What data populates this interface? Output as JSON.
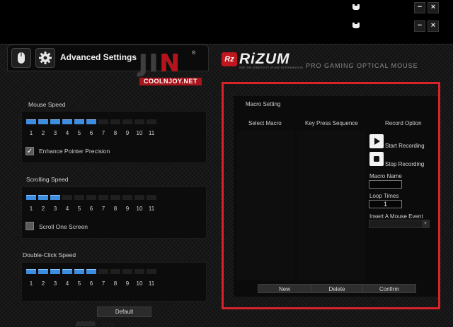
{
  "window": {
    "controls_top": {
      "minimize": "−",
      "close": "×"
    },
    "controls_second": {
      "minimize": "−",
      "close": "×"
    },
    "icons": [
      "mouse-small-icon",
      "mouse-small-icon"
    ]
  },
  "header": {
    "title": "Advanced Settings",
    "mouse_icon": "mouse-icon",
    "gear_icon": "gear-icon"
  },
  "watermark": {
    "logo_text_j": "JI",
    "logo_text_n": "N",
    "registered": "®",
    "site": "COOLNJOY.NET"
  },
  "brand": {
    "badge": "Rz",
    "name": "RiZUM",
    "tagline": "RISE THE SENSITIVITY UP AND DETERMINATION",
    "subtitle": "PRO GAMING OPTICAL MOUSE"
  },
  "mouse_speed": {
    "label": "Mouse Speed",
    "level": 6,
    "max": 11,
    "ticks": [
      "1",
      "2",
      "3",
      "4",
      "5",
      "6",
      "7",
      "8",
      "9",
      "10",
      "11"
    ],
    "enhance_label": "Enhance Pointer Precision",
    "enhance_checked": true
  },
  "scrolling_speed": {
    "label": "Scrolling Speed",
    "level": 3,
    "max": 11,
    "ticks": [
      "1",
      "2",
      "3",
      "4",
      "5",
      "6",
      "7",
      "8",
      "9",
      "10",
      "11"
    ],
    "one_screen_label": "Scroll One Screen",
    "one_screen_checked": false
  },
  "double_click_speed": {
    "label": "Double-Click Speed",
    "level": 6,
    "max": 11,
    "ticks": [
      "1",
      "2",
      "3",
      "4",
      "5",
      "6",
      "7",
      "8",
      "9",
      "10",
      "11"
    ]
  },
  "default_button": "Default",
  "macro": {
    "title": "Macro Setting",
    "col_select": "Select Macro",
    "col_sequence": "Key Press Sequence",
    "col_record": "Record Option",
    "start_recording": "Start Recording",
    "stop_recording": "Stop Recording",
    "macro_name_label": "Macro Name",
    "macro_name_value": "",
    "loop_times_label": "Loop Times",
    "loop_times_value": "1",
    "mouse_event_label": "Insert A Mouse Event",
    "mouse_event_value": "",
    "new_label": "New",
    "delete_label": "Delete",
    "confirm_label": "Confirm"
  },
  "colors": {
    "accent_red": "#d8232a",
    "slider_blue": "#3d8ee0"
  }
}
